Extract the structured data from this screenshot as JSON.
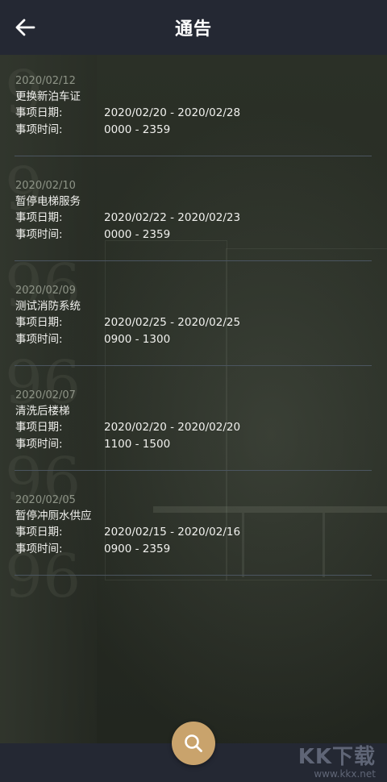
{
  "header": {
    "title": "通告",
    "back_icon": "arrow-left-icon"
  },
  "notices": [
    {
      "posted": "2020/02/12",
      "title": "更换新泊车证",
      "date_label": "事项日期:",
      "date_value": "2020/02/20 - 2020/02/28",
      "time_label": "事项时间:",
      "time_value": "0000 - 2359"
    },
    {
      "posted": "2020/02/10",
      "title": "暂停电梯服务",
      "date_label": "事项日期:",
      "date_value": "2020/02/22 - 2020/02/23",
      "time_label": "事项时间:",
      "time_value": "0000 - 2359"
    },
    {
      "posted": "2020/02/09",
      "title": "测试消防系统",
      "date_label": "事项日期:",
      "date_value": "2020/02/25 - 2020/02/25",
      "time_label": "事项时间:",
      "time_value": "0900 - 1300"
    },
    {
      "posted": "2020/02/07",
      "title": "清洗后楼梯",
      "date_label": "事项日期:",
      "date_value": "2020/02/20 - 2020/02/20",
      "time_label": "事项时间:",
      "time_value": "1100 - 1500"
    },
    {
      "posted": "2020/02/05",
      "title": "暂停冲厕水供应",
      "date_label": "事项日期:",
      "date_value": "2020/02/15 - 2020/02/16",
      "time_label": "事项时间:",
      "time_value": "0900 - 2359"
    }
  ],
  "search_button": {
    "icon": "search-icon",
    "color": "#c9a36c"
  },
  "watermark": {
    "logo": "KK下载",
    "url": "www.kkx.net"
  },
  "colors": {
    "header_bg": "#242833",
    "divider": "#4b5560",
    "date_text": "#8e9487"
  }
}
